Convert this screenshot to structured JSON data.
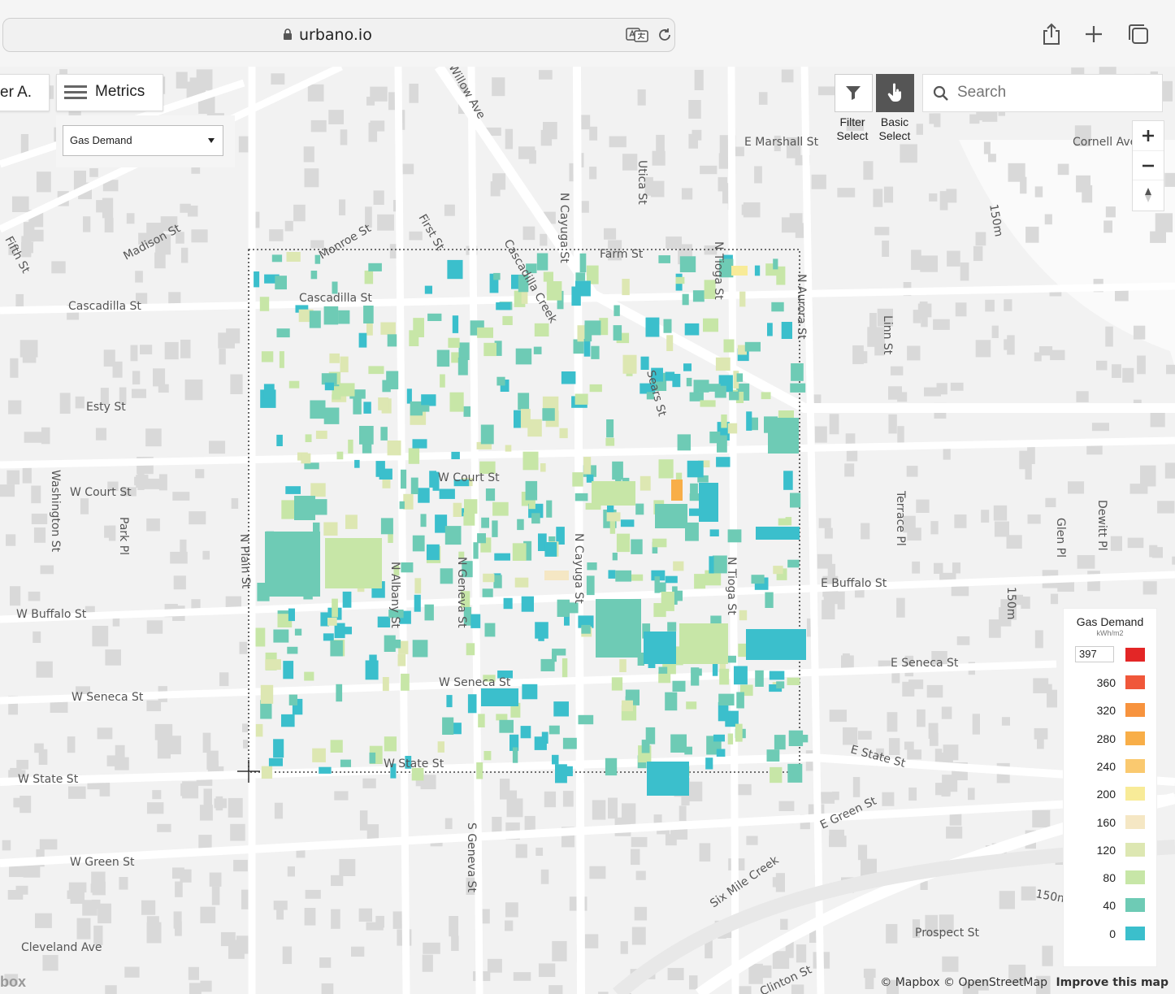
{
  "browser": {
    "url": "urbano.io"
  },
  "toolbar": {
    "user_label": "er A.",
    "metrics_label": "Metrics",
    "metric_select": "Gas Demand",
    "filter_select": [
      "Filter",
      "Select"
    ],
    "basic_select": [
      "Basic",
      "Select"
    ],
    "search_placeholder": "Search"
  },
  "map": {
    "streets": [
      "Fifth St",
      "Madison St",
      "Monroe St",
      "First St",
      "Cascadilla Creek",
      "N Cayuga St",
      "Utica St",
      "E Marshall St",
      "Cornell Ave",
      "Farm St",
      "N Tioga St",
      "N Aurora St",
      "Cascadilla St",
      "Cascadilla St",
      "Linn St",
      "Sears St",
      "Esty St",
      "W Court St",
      "W Court St",
      "Washington St",
      "Park Pl",
      "N Plain St",
      "N Albany St",
      "N Geneva St",
      "N Cayuga St",
      "N Tioga St",
      "E Buffalo St",
      "Terrace Pl",
      "Glen Pl",
      "Dewitt Pl",
      "W Buffalo St",
      "W Seneca St",
      "W Seneca St",
      "E Seneca St",
      "W State St",
      "W State St",
      "E State St",
      "E Green St",
      "W Green St",
      "S Geneva St",
      "Six Mile Creek",
      "Prospect St",
      "Cleveland Ave",
      "Clinton St",
      "Willow Ave"
    ],
    "contours": [
      "150m",
      "150m",
      "150m"
    ]
  },
  "legend": {
    "title": "Gas Demand",
    "unit": "kWh/m2",
    "max_value": "397",
    "ticks": [
      {
        "label": "360",
        "color": "#f0573a"
      },
      {
        "label": "320",
        "color": "#f7933e"
      },
      {
        "label": "280",
        "color": "#f8ae48"
      },
      {
        "label": "240",
        "color": "#fac96f"
      },
      {
        "label": "200",
        "color": "#f8eb98"
      },
      {
        "label": "160",
        "color": "#f5e7c4"
      },
      {
        "label": "120",
        "color": "#dde7b2"
      },
      {
        "label": "80",
        "color": "#c7e6a7"
      },
      {
        "label": "40",
        "color": "#6ecbb5"
      },
      {
        "label": "0",
        "color": "#3bbfcc"
      }
    ],
    "max_color": "#e32626"
  },
  "attribution": {
    "mapbox": "© Mapbox",
    "osm": "© OpenStreetMap",
    "improve": "Improve this map",
    "logo_frag": "box"
  }
}
